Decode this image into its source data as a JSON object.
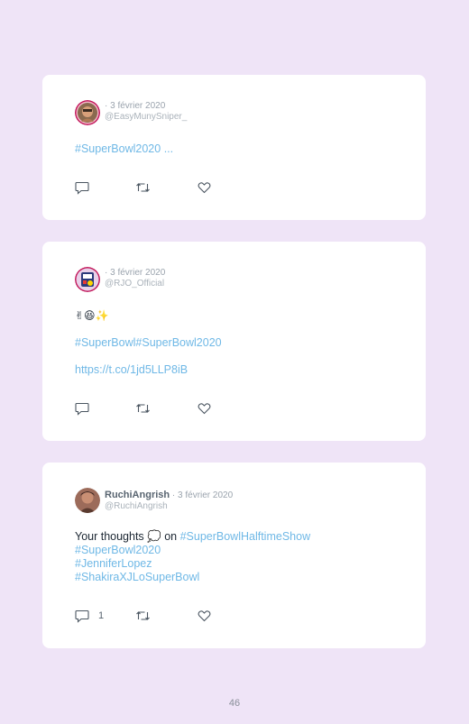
{
  "tweets": [
    {
      "name": "",
      "date": "· 3 février 2020",
      "handle": "@EasyMunySniper_",
      "lines": [
        {
          "parts": [
            {
              "text": "#SuperBowl2020",
              "link": true
            },
            {
              "text": " ...",
              "link": false
            }
          ]
        }
      ],
      "reply_count": ""
    },
    {
      "name": "",
      "date": "· 3 février 2020",
      "handle": "@RJO_Official",
      "lines": [
        {
          "parts": [
            {
              "text": "✌😆✨",
              "link": false
            }
          ]
        },
        {
          "parts": [
            {
              "text": "#SuperBowl",
              "link": true
            },
            {
              "text": "#SuperBowl2020",
              "link": true
            }
          ]
        },
        {
          "parts": [
            {
              "text": "https://t.co/1jd5LLP8iB",
              "link": true
            }
          ]
        }
      ],
      "reply_count": ""
    },
    {
      "name": "RuchiAngrish",
      "date": "· 3 février 2020",
      "handle": "@RuchiAngrish",
      "lines": [
        {
          "parts": [
            {
              "text": "Your thoughts 💭 on ",
              "link": false
            },
            {
              "text": "#SuperBowlHalftimeShow",
              "link": true
            }
          ]
        },
        {
          "parts": [
            {
              "text": "#SuperBowl2020",
              "link": true
            }
          ]
        },
        {
          "parts": [
            {
              "text": "#JenniferLopez",
              "link": true
            }
          ]
        },
        {
          "parts": [
            {
              "text": "#ShakiraXJLoSuperBowl",
              "link": true
            }
          ]
        }
      ],
      "reply_count": "1"
    }
  ],
  "icons": {
    "reply": "comment-icon",
    "retweet": "retweet-icon",
    "like": "heart-icon"
  },
  "colors": {
    "background": "#efe4f7",
    "card": "#ffffff",
    "link": "#6fb8e6",
    "text": "#1c2733",
    "muted": "#9aa3ad"
  },
  "page_number": "46"
}
